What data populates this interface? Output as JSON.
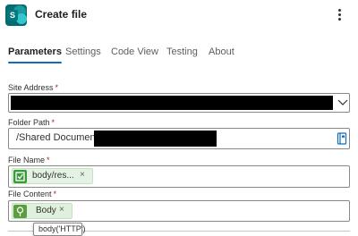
{
  "header": {
    "app_icon": "sharepoint-icon",
    "app_icon_letter": "S",
    "title": "Create file",
    "more_icon": "more-vertical-icon"
  },
  "tabs": [
    {
      "label": "Parameters",
      "active": true
    },
    {
      "label": "Settings",
      "active": false
    },
    {
      "label": "Code View",
      "active": false
    },
    {
      "label": "Testing",
      "active": false
    },
    {
      "label": "About",
      "active": false
    }
  ],
  "form": {
    "site_address": {
      "label": "Site Address",
      "required_mark": "*",
      "value_redacted": true,
      "icon": "chevron-down-icon"
    },
    "folder_path": {
      "label": "Folder Path",
      "required_mark": "*",
      "value_prefix": "/Shared Documents/",
      "value_redacted": true,
      "icon": "folder-picker-icon"
    },
    "file_name": {
      "label": "File Name",
      "required_mark": "*",
      "token": {
        "text": "body/res...",
        "remove": "×",
        "icon": "expression-icon"
      }
    },
    "file_content": {
      "label": "File Content",
      "required_mark": "*",
      "token": {
        "text": "Body",
        "remove": "×",
        "icon": "http-trigger-icon"
      }
    }
  },
  "tooltip": {
    "text": "body('HTTP')"
  },
  "colors": {
    "accent": "#0f6cbd",
    "required": "#a4262c",
    "token_bg": "#e3f2e2",
    "token_icon": "#3a9a3a",
    "app_icon": "#036c70"
  }
}
